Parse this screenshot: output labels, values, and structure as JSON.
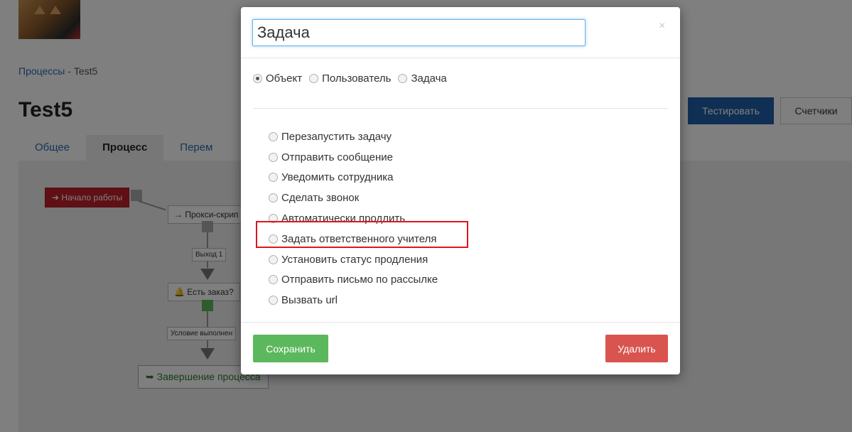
{
  "background": {
    "breadcrumb": {
      "parent": "Процессы",
      "separator": " - ",
      "current": "Test5"
    },
    "page_title": "Test5",
    "tabs": [
      {
        "label": "Общее",
        "active": false
      },
      {
        "label": "Процесс",
        "active": true
      },
      {
        "label": "Перем",
        "active": false
      }
    ],
    "buttons": {
      "test": "Тестировать",
      "counters": "Счетчики"
    },
    "diagram": {
      "start_node": "Начало работы",
      "proxy_node": "Прокси-скрип",
      "exit_label": "Выход 1",
      "order_node": "Есть заказ?",
      "condition_label": "Условие выполнен",
      "finish_node": "Завершение процесса"
    }
  },
  "modal": {
    "title_value": "Задача",
    "close_symbol": "×",
    "type_options": [
      {
        "label": "Объект",
        "checked": true
      },
      {
        "label": "Пользователь",
        "checked": false
      },
      {
        "label": "Задача",
        "checked": false
      }
    ],
    "actions": [
      {
        "label": "Перезапустить задачу",
        "checked": false
      },
      {
        "label": "Отправить сообщение",
        "checked": false
      },
      {
        "label": "Уведомить сотрудника",
        "checked": false
      },
      {
        "label": "Сделать звонок",
        "checked": false
      },
      {
        "label": "Автоматически продлить",
        "checked": false
      },
      {
        "label": "Задать ответственного учителя",
        "checked": false,
        "highlighted": true
      },
      {
        "label": "Установить статус продления",
        "checked": false
      },
      {
        "label": "Отправить письмо по рассылке",
        "checked": false
      },
      {
        "label": "Вызвать url",
        "checked": false
      }
    ],
    "save_label": "Сохранить",
    "delete_label": "Удалить"
  },
  "colors": {
    "primary": "#1f5fa8",
    "success": "#5cb85c",
    "danger": "#d9534f",
    "highlight_border": "#e0141e",
    "start_node": "#c0212b"
  }
}
